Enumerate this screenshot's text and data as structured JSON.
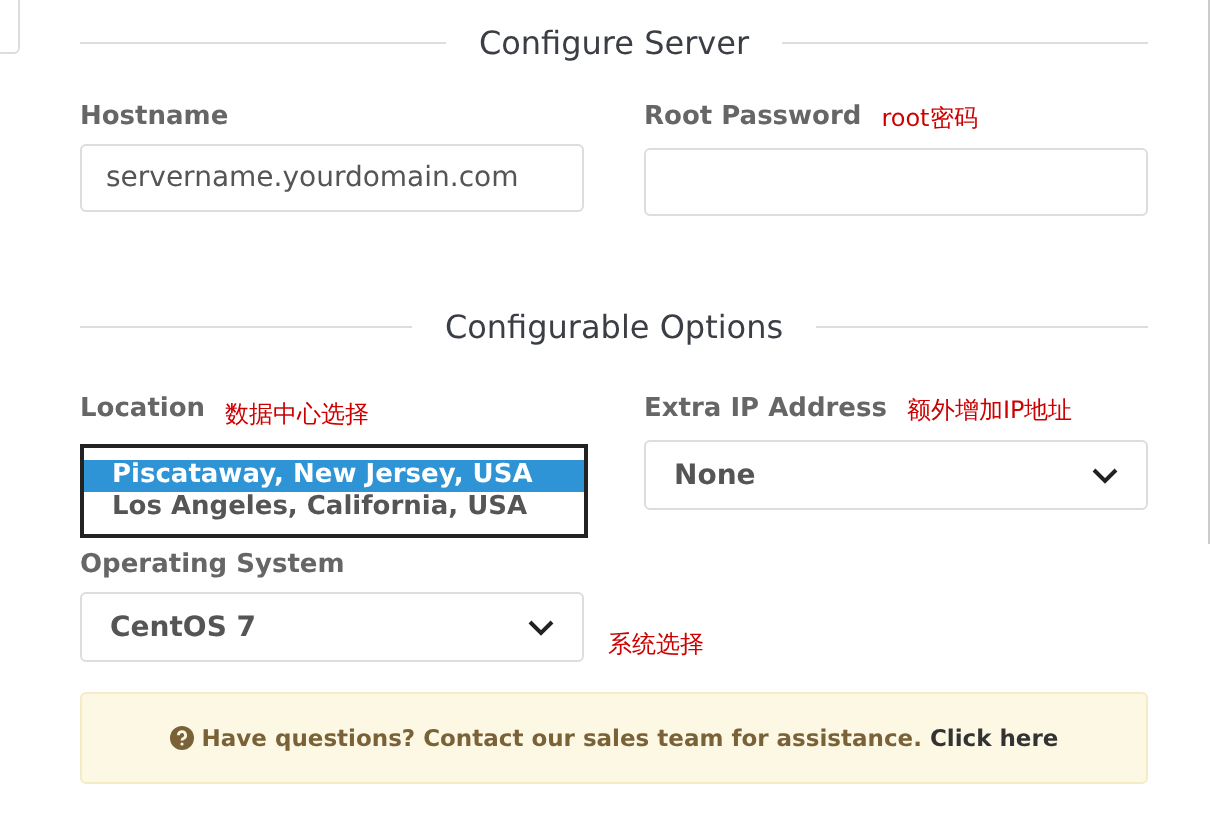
{
  "sections": [
    {
      "title": "Configure Server"
    },
    {
      "title": "Configurable Options"
    }
  ],
  "hostname": {
    "label": "Hostname",
    "value": "servername.yourdomain.com"
  },
  "root_password": {
    "label": "Root Password",
    "note": "root密码"
  },
  "location": {
    "label": "Location",
    "note": "数据中心选择",
    "options": [
      {
        "label": "Piscataway, New Jersey, USA",
        "selected": true
      },
      {
        "label": "Los Angeles, California, USA",
        "selected": false
      }
    ]
  },
  "extra_ip": {
    "label": "Extra IP Address",
    "note": "额外增加IP地址",
    "value": "None"
  },
  "operating_system": {
    "label": "Operating System",
    "value": "CentOS 7",
    "note": "系统选择"
  },
  "alert": {
    "text": "Have questions? Contact our sales team for assistance.",
    "link": "Click here"
  }
}
